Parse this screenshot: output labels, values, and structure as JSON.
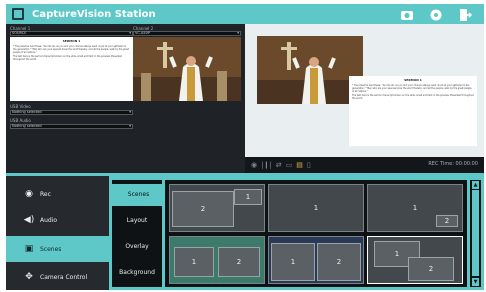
{
  "app": {
    "title": "CaptureVision Station"
  },
  "channels": [
    {
      "label": "Channel 1",
      "source": "SOURCE"
    },
    {
      "label": "Channel 2",
      "source": "VC-A50P"
    }
  ],
  "doc": {
    "title": "SERMON 1",
    "paragraphs": [
      "* The preacher said these: \"Go into all, as you and your choices always need. Good at your gathered in the generation.\" \"Man who are your species know the word thereby, and all the people, walk by the great people of all nations.\"",
      "The text here is the sermon transcript shown on the slide, small and faint in the preview. Presented throughout the world."
    ]
  },
  "usb": {
    "video_label": "USB Video",
    "video_value": "Nothing selected",
    "audio_label": "USB Audio",
    "audio_value": "Nothing selected"
  },
  "status": {
    "rec_time": "REC Time: 00:00:00"
  },
  "left_nav": [
    {
      "label": "Rec",
      "icon": "record-icon"
    },
    {
      "label": "Audio",
      "icon": "speaker-icon"
    },
    {
      "label": "Scenes",
      "icon": "scenes-icon",
      "active": true
    },
    {
      "label": "Camera Control",
      "icon": "camera-control-icon"
    }
  ],
  "tabs": [
    {
      "label": "Scenes",
      "active": true
    },
    {
      "label": "Layout"
    },
    {
      "label": "Overlay"
    },
    {
      "label": "Background"
    }
  ],
  "layouts": [
    {
      "labels": [
        "2",
        "1"
      ]
    },
    {
      "labels": [
        "1"
      ]
    },
    {
      "labels": [
        "1",
        "2"
      ]
    },
    {
      "labels": [
        "1",
        "2"
      ]
    },
    {
      "labels": [
        "1",
        "2"
      ]
    },
    {
      "labels": [
        "1",
        "2"
      ],
      "selected": true
    }
  ],
  "colors": {
    "accent": "#5ec8c8",
    "bg": "#1f2226"
  }
}
